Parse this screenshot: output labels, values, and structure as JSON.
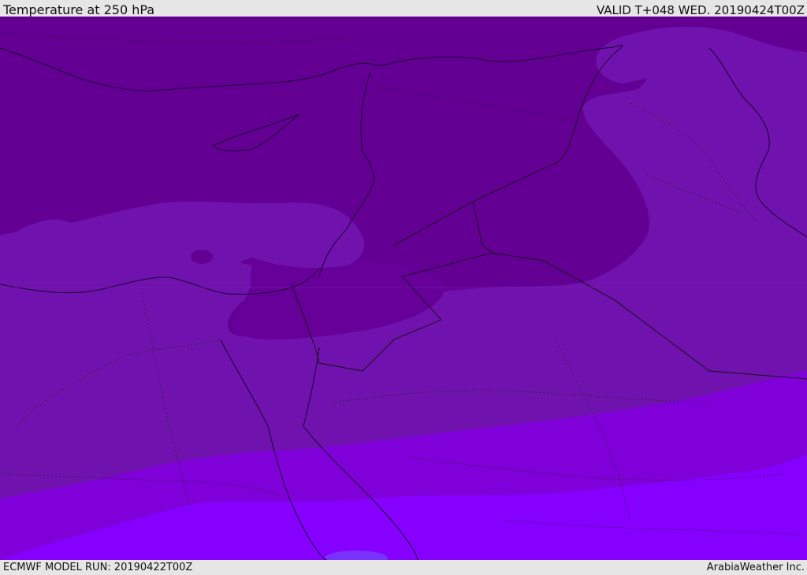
{
  "header": {
    "title": "Temperature at 250 hPa",
    "valid": "VALID T+048 WED. 20190424T00Z"
  },
  "footer": {
    "model_run": "ECMWF MODEL RUN: 20190422T00Z",
    "credit": "ArabiaWeather Inc."
  },
  "colors": {
    "band_coldest": "#630093",
    "band_cold": "#7012ad",
    "band_mid": "#7f00d8",
    "band_warm": "#8600ff",
    "band_warmest": "#7a33ff",
    "coastline": "#1a0030",
    "chrome_bg": "#e6e6e6"
  }
}
